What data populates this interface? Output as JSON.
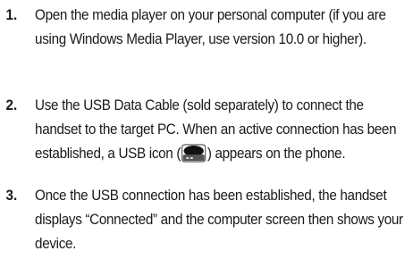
{
  "steps": [
    {
      "number": "1.",
      "text": "Open the media player on your personal computer (if you are using Windows Media Player, use version 10.0 or higher)."
    },
    {
      "number": "2.",
      "text_before_icon": "Use the USB Data Cable (sold separately) to connect the handset to the target PC. When an active connection has been established, a USB icon (",
      "icon": "usb-connection-icon",
      "text_after_icon": ") appears on the phone."
    },
    {
      "number": "3.",
      "text": "Once the USB connection has been established, the handset displays “Connected” and the computer screen then shows your device."
    }
  ]
}
